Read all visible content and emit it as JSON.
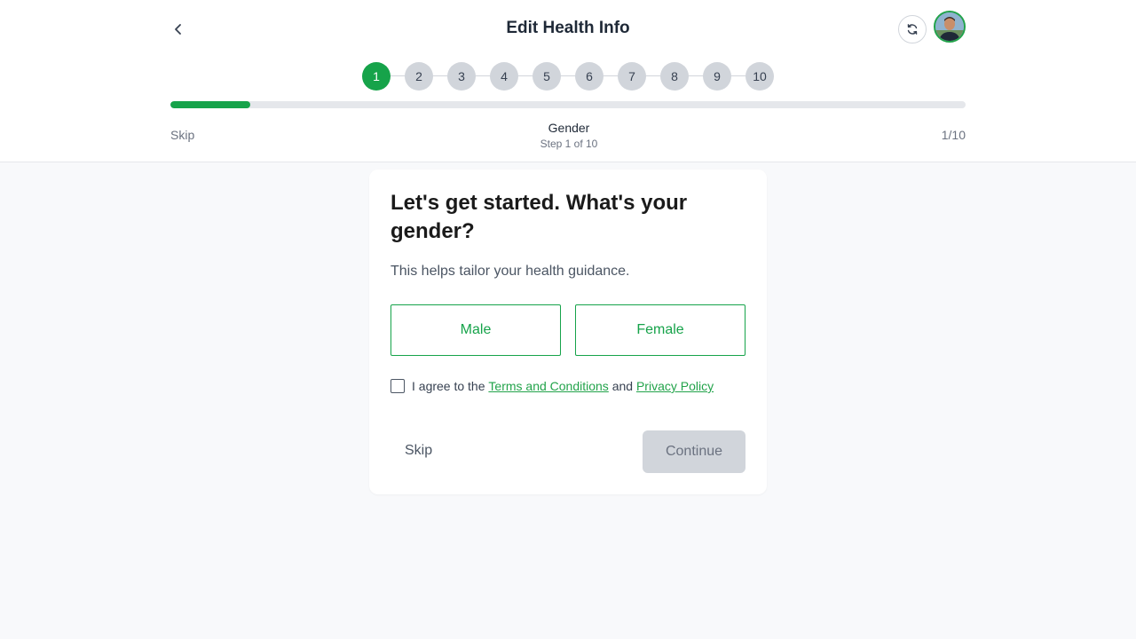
{
  "header": {
    "title": "Edit Health Info",
    "back_icon": "chevron-left-icon",
    "sync_icon": "sync-icon"
  },
  "stepper": {
    "steps": [
      "1",
      "2",
      "3",
      "4",
      "5",
      "6",
      "7",
      "8",
      "9",
      "10"
    ],
    "active_index": 0
  },
  "progress": {
    "fraction": 0.1,
    "skip_label": "Skip",
    "step_name": "Gender",
    "step_subtitle": "Step 1 of 10",
    "count": "1/10"
  },
  "card": {
    "question": "Let's get started. What's your gender?",
    "subtext": "This helps tailor your health guidance.",
    "options": [
      "Male",
      "Female"
    ],
    "agree_prefix": "I agree to the",
    "terms_link": "Terms and Conditions",
    "agree_and": "and",
    "privacy_link": "Privacy Policy",
    "agree_checked": false,
    "skip_label": "Skip",
    "continue_label": "Continue"
  },
  "colors": {
    "accent": "#16a34a",
    "disabled_bg": "#d1d5db",
    "page_bg": "#f8f9fb"
  }
}
